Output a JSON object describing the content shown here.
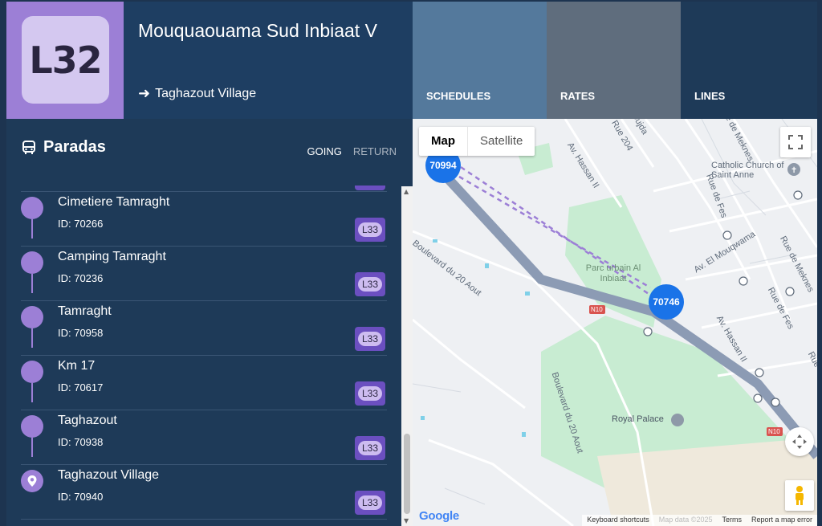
{
  "route": {
    "line_code": "L32",
    "title": "Mouquaouama Sud Inbiaat V",
    "destination": "Taghazout Village"
  },
  "tabs": {
    "schedules": "SCHEDULES",
    "rates": "RATES",
    "lines": "LINES"
  },
  "panel": {
    "heading": "Paradas",
    "direction_going": "GOING",
    "direction_return": "RETURN"
  },
  "stops": [
    {
      "name": "Cimetiere Tamraght",
      "id": "ID: 70266",
      "line": "L33"
    },
    {
      "name": "Camping Tamraght",
      "id": "ID: 70236",
      "line": "L33"
    },
    {
      "name": "Tamraght",
      "id": "ID: 70958",
      "line": "L33"
    },
    {
      "name": "Km 17",
      "id": "ID: 70617",
      "line": "L33"
    },
    {
      "name": "Taghazout",
      "id": "ID: 70938",
      "line": "L33"
    },
    {
      "name": "Taghazout Village",
      "id": "ID: 70940",
      "line": "L33"
    }
  ],
  "map": {
    "type_map": "Map",
    "type_satellite": "Satellite",
    "markers": [
      "70994",
      "70746"
    ],
    "labels": {
      "oujda": "Oujda",
      "rue204": "Rue 204",
      "hassan2a": "Av. Hassan II",
      "hassan2b": "Av. Hassan II",
      "meknes1": "Rue de Meknes",
      "meknes2": "Rue de Meknes",
      "church": "Catholic Church of Saint Anne",
      "fes1": "Rue de Fes",
      "fes2": "Rue de Fes",
      "fes3": "Rue de Fes",
      "mouqwama": "Av. El Mouqwama",
      "boul1": "Boulevard du 20 Aout",
      "boul2": "Boulevard du 20 Aout",
      "parc": "Parc urbain Al Inbiaat",
      "palace": "Royal Palace",
      "n10a": "N10",
      "n10b": "N10"
    },
    "logo": "Google",
    "footer_shortcuts": "Keyboard shortcuts",
    "footer_data": "Map data ©2025",
    "footer_terms": "Terms",
    "footer_report": "Report a map error"
  },
  "colors": {
    "accent": "#9c7fd6",
    "line_tag": "#6b4fc0",
    "marker": "#1a73e8",
    "panel": "#1e3a58"
  }
}
